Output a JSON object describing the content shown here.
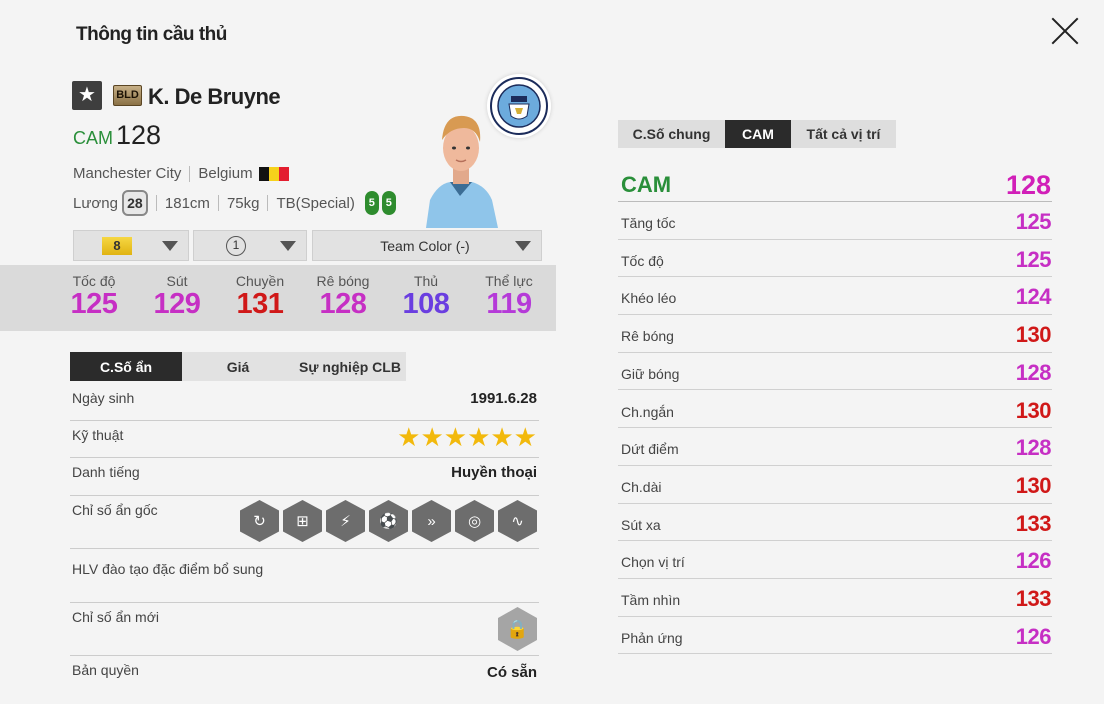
{
  "window": {
    "title": "Thông tin cầu thủ"
  },
  "player": {
    "season": "BLD",
    "name": "K. De Bruyne",
    "position": "CAM",
    "ovr": "128",
    "club": "Manchester City",
    "nation": "Belgium",
    "salary_label": "Lương",
    "salary": "28",
    "height": "181cm",
    "weight": "75kg",
    "body_type": "TB(Special)",
    "foot_left": "5",
    "foot_right": "5"
  },
  "dropdowns": {
    "grade": "8",
    "level": "1",
    "team_color": "Team Color (-)"
  },
  "summary_stats": [
    {
      "label": "Tốc độ",
      "value": "125",
      "color": "#c62fc4"
    },
    {
      "label": "Sút",
      "value": "129",
      "color": "#c62fc4"
    },
    {
      "label": "Chuyền",
      "value": "131",
      "color": "#d01818"
    },
    {
      "label": "Rê bóng",
      "value": "128",
      "color": "#c62fc4"
    },
    {
      "label": "Thủ",
      "value": "108",
      "color": "#6a3ee0"
    },
    {
      "label": "Thể lực",
      "value": "119",
      "color": "#b53ad8"
    }
  ],
  "left_tabs": [
    "C.Số ẩn",
    "Giá",
    "Sự nghiệp CLB"
  ],
  "details": {
    "birth_label": "Ngày sinh",
    "birth": "1991.6.28",
    "skill_label": "Kỹ thuật",
    "skill_stars": "★★★★★★",
    "fame_label": "Danh tiếng",
    "fame": "Huyền thoại",
    "traits_label": "Chỉ số ẩn gốc",
    "traits_icons": [
      "trait-curl-icon",
      "trait-goal-icon",
      "trait-power-icon",
      "trait-dribble-icon",
      "trait-speed-icon",
      "trait-shot-icon",
      "trait-pass-icon"
    ],
    "coach_label": "HLV đào tạo đặc điểm bổ sung",
    "new_traits_label": "Chỉ số ẩn mới",
    "license_label": "Bản quyền",
    "license": "Có sẵn"
  },
  "right_tabs": [
    "C.Số chung",
    "CAM",
    "Tất cả vị trí"
  ],
  "position_stats": {
    "position": "CAM",
    "ovr": "128",
    "rows": [
      {
        "label": "Tăng tốc",
        "value": "125",
        "color": "#c62fc4"
      },
      {
        "label": "Tốc độ",
        "value": "125",
        "color": "#c62fc4"
      },
      {
        "label": "Khéo léo",
        "value": "124",
        "color": "#c62fc4"
      },
      {
        "label": "Rê bóng",
        "value": "130",
        "color": "#d01818"
      },
      {
        "label": "Giữ bóng",
        "value": "128",
        "color": "#c62fc4"
      },
      {
        "label": "Ch.ngắn",
        "value": "130",
        "color": "#d01818"
      },
      {
        "label": "Dứt điểm",
        "value": "128",
        "color": "#c62fc4"
      },
      {
        "label": "Ch.dài",
        "value": "130",
        "color": "#d01818"
      },
      {
        "label": "Sút xa",
        "value": "133",
        "color": "#d01818"
      },
      {
        "label": "Chọn vị trí",
        "value": "126",
        "color": "#c62fc4"
      },
      {
        "label": "Tầm nhìn",
        "value": "133",
        "color": "#d01818"
      },
      {
        "label": "Phản ứng",
        "value": "126",
        "color": "#c62fc4"
      }
    ]
  }
}
